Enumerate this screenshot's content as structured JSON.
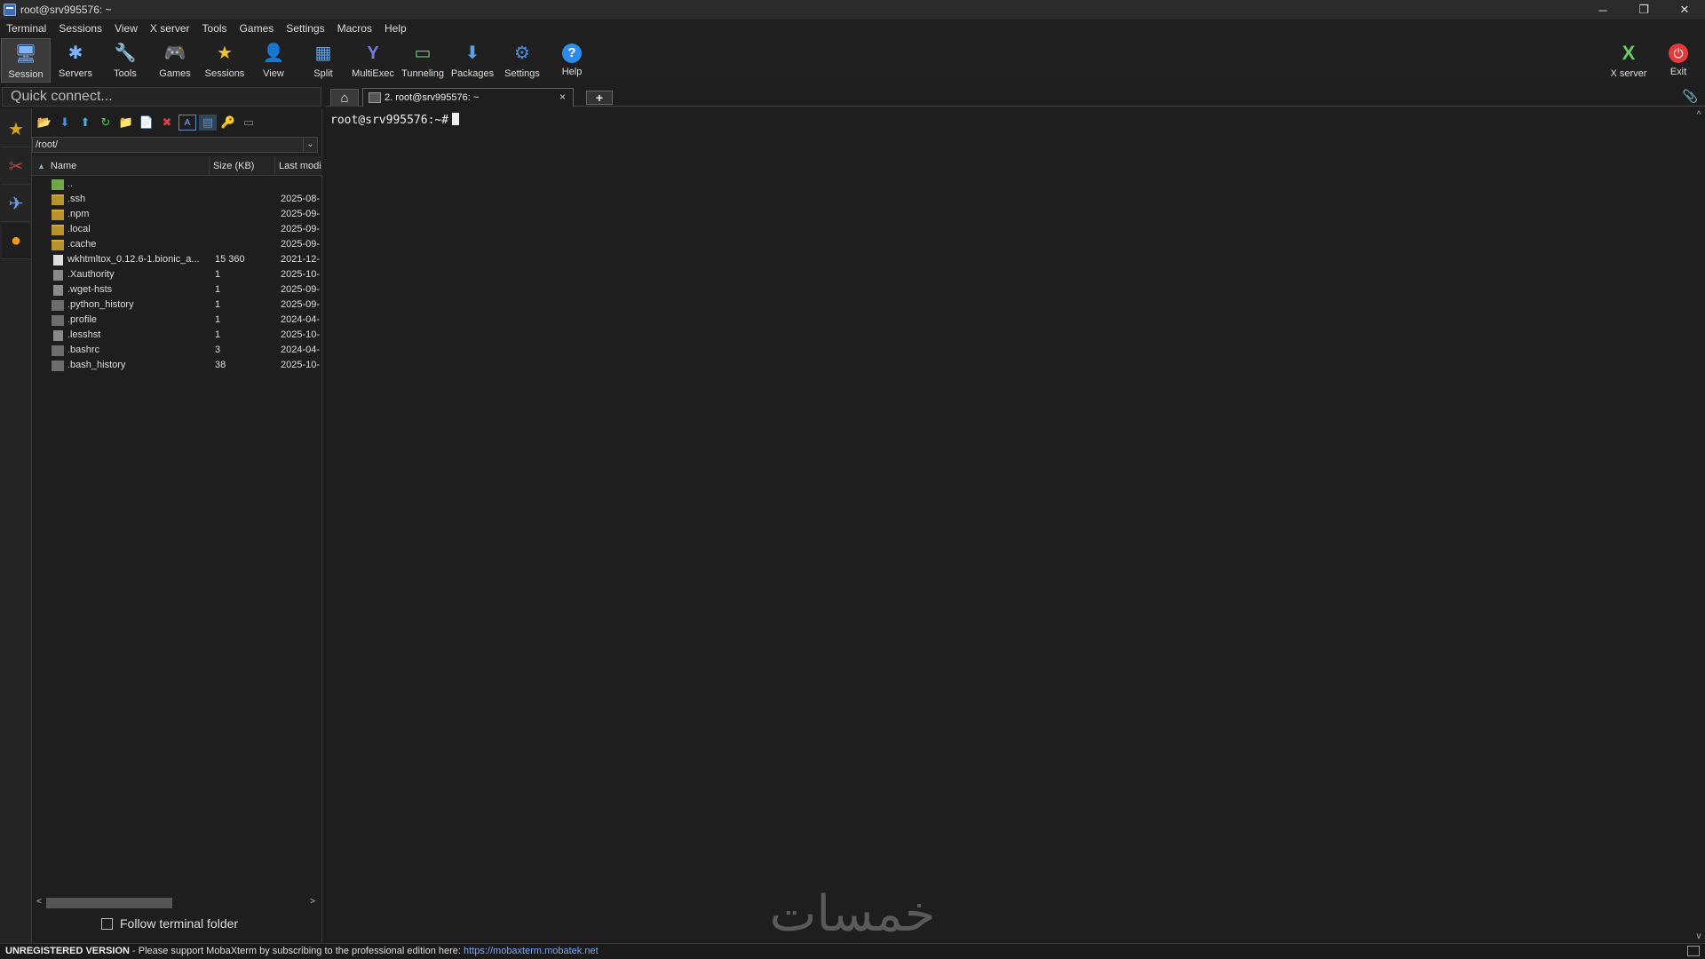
{
  "window": {
    "title": "root@srv995576: ~",
    "controls": {
      "minimize": "─",
      "restore": "❐",
      "close": "✕"
    }
  },
  "menu": [
    "Terminal",
    "Sessions",
    "View",
    "X server",
    "Tools",
    "Games",
    "Settings",
    "Macros",
    "Help"
  ],
  "toolbar": {
    "buttons": [
      {
        "label": "Session",
        "icon": "session-icon",
        "glyph": "🖥"
      },
      {
        "label": "Servers",
        "icon": "servers-icon",
        "glyph": "✱"
      },
      {
        "label": "Tools",
        "icon": "tools-icon",
        "glyph": "🔧"
      },
      {
        "label": "Games",
        "icon": "games-icon",
        "glyph": "🎮"
      },
      {
        "label": "Sessions",
        "icon": "star-icon",
        "glyph": "★"
      },
      {
        "label": "View",
        "icon": "view-icon",
        "glyph": "👤"
      },
      {
        "label": "Split",
        "icon": "split-icon",
        "glyph": "▦"
      },
      {
        "label": "MultiExec",
        "icon": "multiexec-icon",
        "glyph": "Y"
      },
      {
        "label": "Tunneling",
        "icon": "tunneling-icon",
        "glyph": "▭"
      },
      {
        "label": "Packages",
        "icon": "packages-icon",
        "glyph": "⬇"
      },
      {
        "label": "Settings",
        "icon": "settings-icon",
        "glyph": "⚙"
      },
      {
        "label": "Help",
        "icon": "help-icon",
        "glyph": "?"
      }
    ],
    "right": [
      {
        "label": "X server",
        "icon": "xserver-icon",
        "glyph": "X"
      },
      {
        "label": "Exit",
        "icon": "power-icon",
        "glyph": "⏻"
      }
    ]
  },
  "quick_connect": {
    "placeholder": "Quick connect..."
  },
  "tabs": {
    "home_glyph": "⌂",
    "session_label": "2. root@srv995576: ~",
    "close_glyph": "×",
    "new_glyph": "+",
    "attach_glyph": "📎"
  },
  "sidestrip": [
    {
      "icon": "star-icon",
      "glyph": "★"
    },
    {
      "icon": "tools-icon",
      "glyph": "✂"
    },
    {
      "icon": "send-icon",
      "glyph": "✈"
    },
    {
      "icon": "sftp-icon",
      "glyph": "●"
    }
  ],
  "file_browser": {
    "toolbar_glyphs": [
      "📂",
      "⬇",
      "⬆",
      "↻",
      "📁",
      "📄",
      "✖",
      "A",
      "▤",
      "🔑",
      "▭"
    ],
    "path": "/root/",
    "dropdown_glyph": "⌄",
    "columns": {
      "name": "Name",
      "size": "Size (KB)",
      "modified": "Last modi",
      "sort_glyph": "▲"
    },
    "rows": [
      {
        "name": "..",
        "size": "",
        "date": "",
        "type": "up"
      },
      {
        "name": ".ssh",
        "size": "",
        "date": "2025-08-",
        "type": "folder"
      },
      {
        "name": ".npm",
        "size": "",
        "date": "2025-09-",
        "type": "folder"
      },
      {
        "name": ".local",
        "size": "",
        "date": "2025-09-",
        "type": "folder"
      },
      {
        "name": ".cache",
        "size": "",
        "date": "2025-09-",
        "type": "folder"
      },
      {
        "name": "wkhtmltox_0.12.6-1.bionic_a...",
        "size": "15 360",
        "date": "2021-12-",
        "type": "doc"
      },
      {
        "name": ".Xauthority",
        "size": "1",
        "date": "2025-10-",
        "type": "file"
      },
      {
        "name": ".wget-hsts",
        "size": "1",
        "date": "2025-09-",
        "type": "file"
      },
      {
        "name": ".python_history",
        "size": "1",
        "date": "2025-09-",
        "type": "file2"
      },
      {
        "name": ".profile",
        "size": "1",
        "date": "2024-04-",
        "type": "file2"
      },
      {
        "name": ".lesshst",
        "size": "1",
        "date": "2025-10-",
        "type": "file"
      },
      {
        "name": ".bashrc",
        "size": "3",
        "date": "2024-04-",
        "type": "file2"
      },
      {
        "name": ".bash_history",
        "size": "38",
        "date": "2025-10-",
        "type": "file2"
      }
    ],
    "scroll_left": "<",
    "scroll_right": ">",
    "follow_label": "Follow terminal folder"
  },
  "terminal": {
    "prompt": "root@srv995576:~#",
    "scroll_up": "^",
    "scroll_down": "v"
  },
  "watermark": "خمسات",
  "status": {
    "unregistered": "UNREGISTERED VERSION",
    "message": " -  Please support MobaXterm by subscribing to the professional edition here:  ",
    "link": "https://mobaxterm.mobatek.net"
  },
  "colors": {
    "background": "#1e1e1e",
    "accent_link": "#6fa8ff"
  }
}
